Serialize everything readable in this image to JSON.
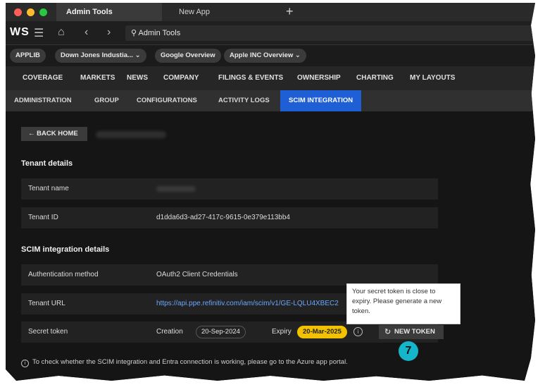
{
  "browser": {
    "tabs": [
      {
        "label": "Admin Tools",
        "active": true
      },
      {
        "label": "New App",
        "active": false
      }
    ],
    "new_tab_icon": "plus-icon",
    "logo": "WS",
    "address": "Admin Tools"
  },
  "app_tabs": [
    {
      "label": "APPLIB"
    },
    {
      "label": "Down Jones Industia... ⌄"
    },
    {
      "label": "Google Overview"
    },
    {
      "label": "Apple INC Overview ⌄"
    }
  ],
  "main_nav": [
    "COVERAGE",
    "MARKETS",
    "NEWS",
    "COMPANY",
    "FILINGS & EVENTS",
    "OWNERSHIP",
    "CHARTING",
    "MY LAYOUTS"
  ],
  "sub_nav": [
    {
      "label": "ADMINISTRATION",
      "selected": false
    },
    {
      "label": "GROUP",
      "selected": false
    },
    {
      "label": "CONFIGURATIONS",
      "selected": false
    },
    {
      "label": "ACTIVITY LOGS",
      "selected": false
    },
    {
      "label": "SCIM INTEGRATION",
      "selected": true
    }
  ],
  "content": {
    "back_label": "← BACK HOME",
    "tenant_section": {
      "title": "Tenant details",
      "rows": [
        {
          "label": "Tenant name",
          "value": ""
        },
        {
          "label": "Tenant ID",
          "value": "d1dda6d3-ad27-417c-9615-0e379e113bb4"
        }
      ]
    },
    "scim_section": {
      "title": "SCIM integration details",
      "auth_label": "Authentication method",
      "auth_value": "OAuth2 Client Credentials",
      "url_label": "Tenant URL",
      "url_value": "https://api.ppe.refinitiv.com/iam/scim/v1/GE-LQLU4XBEC2",
      "secret_label": "Secret token",
      "creation_label": "Creation",
      "creation_value": "20-Sep-2024",
      "expiry_label": "Expiry",
      "expiry_value": "20-Mar-2025",
      "new_token_label": "NEW TOKEN"
    },
    "tooltip": "Your secret token is close to expiry. Please generate a new token.",
    "footnote": "To check whether the SCIM integration and Entra connection is working, please go to the Azure app portal.",
    "step_badge": "7"
  },
  "colors": {
    "accent": "#1f5fd6",
    "warning": "#f2c200",
    "link": "#6aa8ff",
    "badge": "#15b6c9"
  }
}
